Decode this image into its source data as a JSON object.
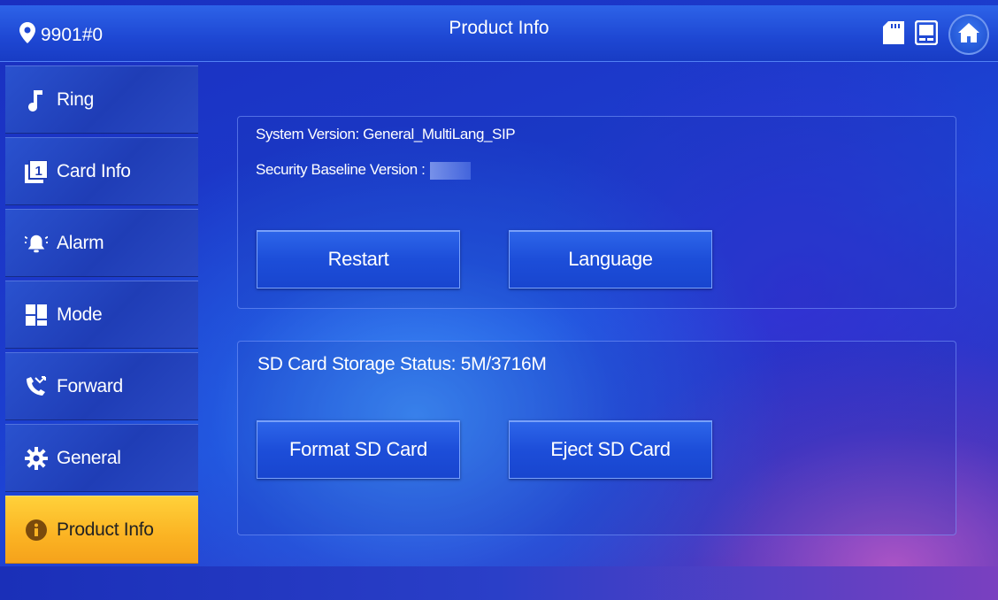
{
  "topbar": {
    "location": "9901#0",
    "title": "Product Info"
  },
  "sidebar": {
    "items": [
      {
        "label": "Ring",
        "icon": "music-note-icon"
      },
      {
        "label": "Card Info",
        "icon": "card-icon"
      },
      {
        "label": "Alarm",
        "icon": "alarm-icon"
      },
      {
        "label": "Mode",
        "icon": "mode-icon"
      },
      {
        "label": "Forward",
        "icon": "forward-call-icon"
      },
      {
        "label": "General",
        "icon": "gear-icon"
      },
      {
        "label": "Product Info",
        "icon": "info-icon"
      }
    ],
    "active_index": 6
  },
  "system_panel": {
    "system_version": "System Version: General_MultiLang_SIP",
    "security_baseline": "Security Baseline Version :",
    "restart_label": "Restart",
    "language_label": "Language"
  },
  "sd_panel": {
    "storage_status": "SD Card Storage Status: 5M/3716M",
    "format_label": "Format SD Card",
    "eject_label": "Eject SD Card"
  },
  "colors": {
    "accent_active": "#fbb323",
    "button_blue": "#1d4ed9"
  }
}
